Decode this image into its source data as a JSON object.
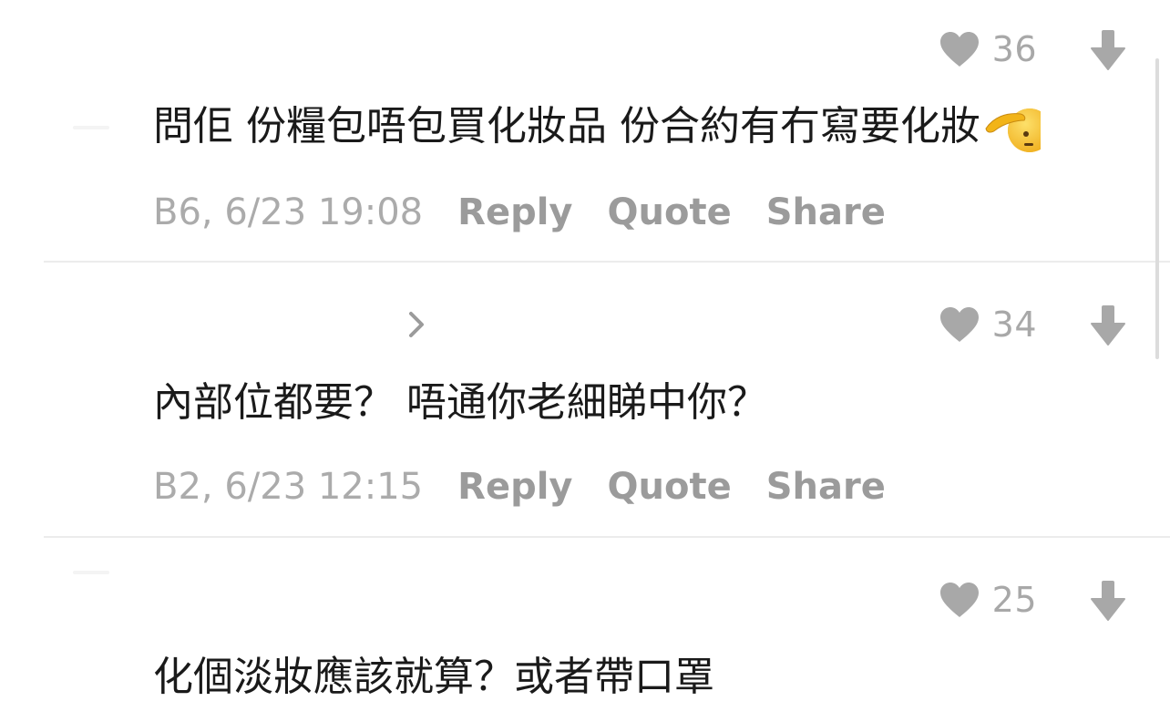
{
  "comments": [
    {
      "likes": "36",
      "text": "問佢 份糧包唔包買化妝品 份合約有冇寫要化妝",
      "emoji": "saluting-face-emoji",
      "timestamp": "B6, 6/23 19:08",
      "actions": {
        "reply": "Reply",
        "quote": "Quote",
        "share": "Share"
      }
    },
    {
      "likes": "34",
      "text": "內部位都要？ 唔通你老細睇中你？",
      "has_chevron": true,
      "timestamp": "B2, 6/23 12:15",
      "actions": {
        "reply": "Reply",
        "quote": "Quote",
        "share": "Share"
      }
    },
    {
      "likes": "25",
      "text": "化個淡妝應該就算？或者帶口罩"
    }
  ],
  "colors": {
    "icon_gray": "#a8a8a8",
    "body_text": "#1a1a1a",
    "meta_text": "#ababab",
    "action_text": "#9b9b9b",
    "divider": "#ececec"
  },
  "icons": {
    "like": "heart-icon",
    "downvote": "arrow-down-icon",
    "expand": "chevron-right-icon"
  }
}
